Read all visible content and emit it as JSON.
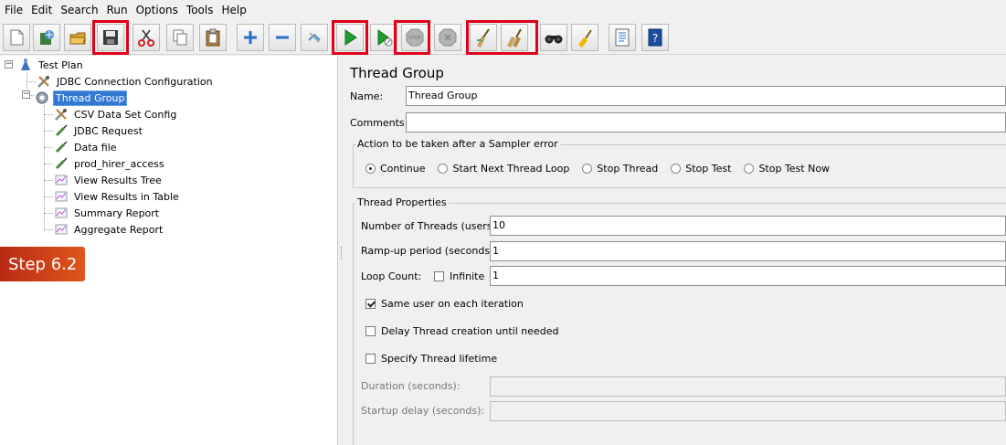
{
  "menu": [
    "File",
    "Edit",
    "Search",
    "Run",
    "Options",
    "Tools",
    "Help"
  ],
  "toolbar": {
    "buttons": [
      "new-icon",
      "templates-icon",
      "open-icon",
      "save-icon",
      "cut-icon",
      "copy-icon",
      "paste-icon",
      "expand-icon",
      "collapse-icon",
      "toggle-icon",
      "start-icon",
      "start-no-pause-icon",
      "stop-icon",
      "shutdown-icon",
      "clear-icon",
      "clear-all-icon",
      "search-icon",
      "reset-search-icon",
      "function-helper-icon",
      "help-icon"
    ],
    "highlight_color": "#e0001a"
  },
  "tree": {
    "items": [
      {
        "label": "Test Plan"
      },
      {
        "label": "JDBC Connection Configuration"
      },
      {
        "label": "Thread Group"
      },
      {
        "label": "CSV Data Set Config"
      },
      {
        "label": "JDBC Request"
      },
      {
        "label": "Data file"
      },
      {
        "label": "prod_hirer_access"
      },
      {
        "label": "View Results Tree"
      },
      {
        "label": "View Results in Table"
      },
      {
        "label": "Summary Report"
      },
      {
        "label": "Aggregate Report"
      }
    ],
    "selected": "Thread Group"
  },
  "step_badge": "Step 6.2",
  "panel": {
    "title": "Thread Group",
    "name_label": "Name:",
    "name_value": "Thread Group",
    "comments_label": "Comments:",
    "comments_value": "",
    "sampler_error": {
      "legend": "Action to be taken after a Sampler error",
      "options": [
        "Continue",
        "Start Next Thread Loop",
        "Stop Thread",
        "Stop Test",
        "Stop Test Now"
      ],
      "selected": "Continue"
    },
    "thread_props": {
      "legend": "Thread Properties",
      "threads_label": "Number of Threads (users):",
      "threads_value": "10",
      "rampup_label": "Ramp-up period (seconds):",
      "rampup_value": "1",
      "loop_label": "Loop Count:",
      "infinite_label": "Infinite",
      "loop_value": "1",
      "same_user_label": "Same user on each iteration",
      "delay_label": "Delay Thread creation until needed",
      "lifetime_label": "Specify Thread lifetime",
      "duration_label": "Duration (seconds):",
      "startup_label": "Startup delay (seconds):"
    }
  }
}
